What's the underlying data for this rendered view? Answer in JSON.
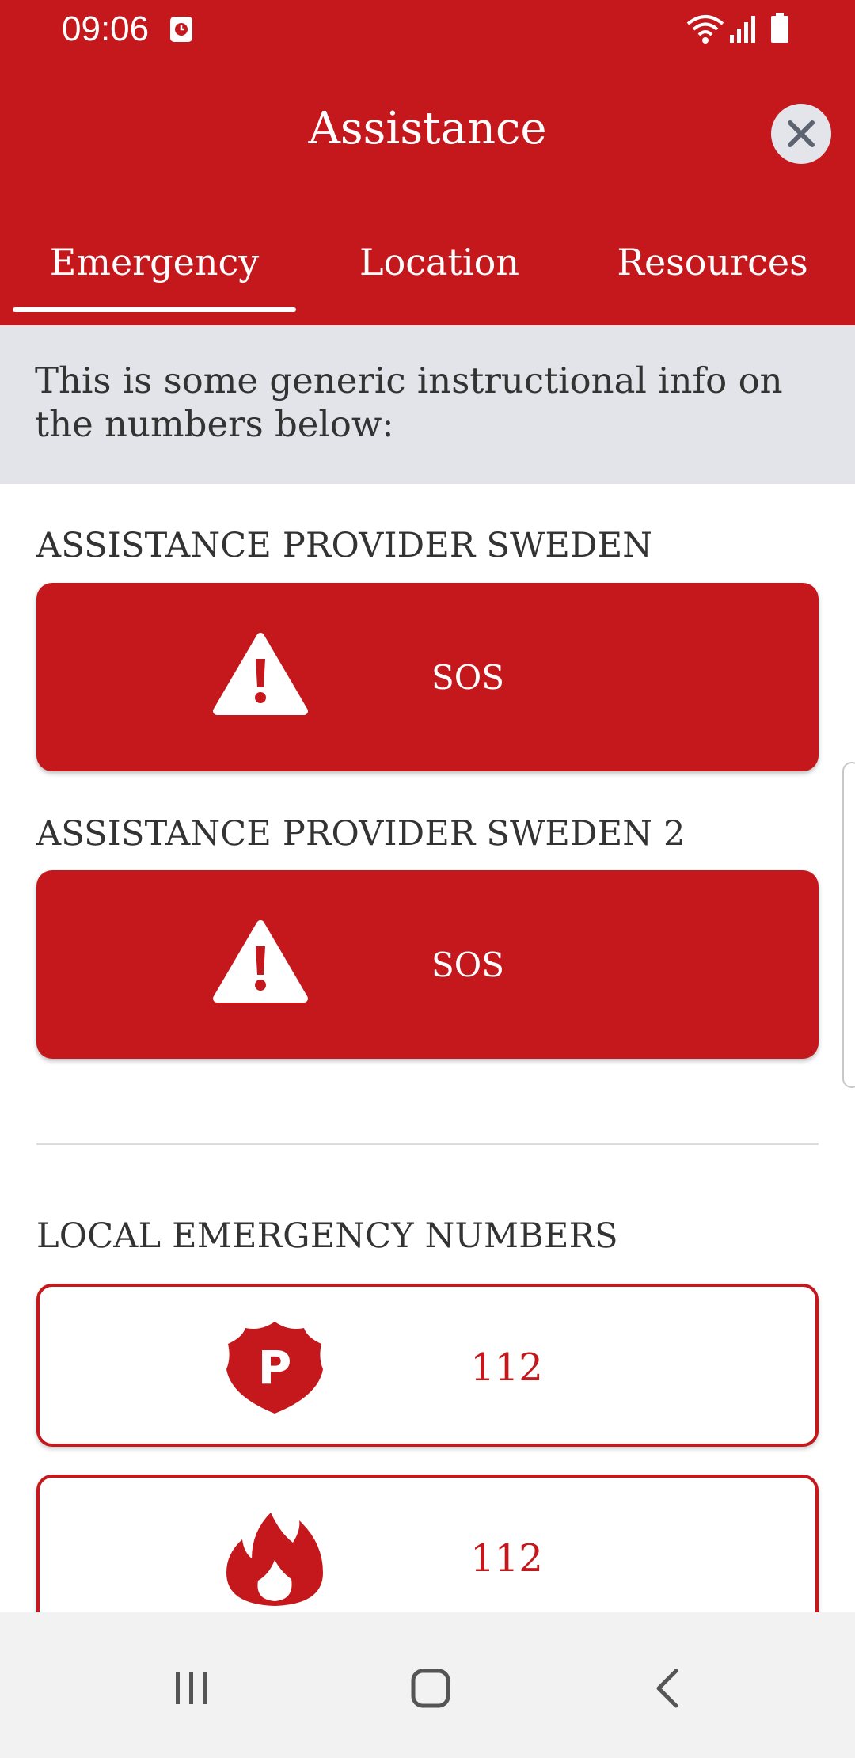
{
  "status_bar": {
    "time": "09:06"
  },
  "header": {
    "title": "Assistance",
    "tabs": [
      {
        "label": "Emergency",
        "active": true
      },
      {
        "label": "Location",
        "active": false
      },
      {
        "label": "Resources",
        "active": false
      }
    ]
  },
  "info": {
    "text": "This is some generic instructional info on the numbers below:"
  },
  "providers": [
    {
      "heading": "ASSISTANCE PROVIDER SWEDEN",
      "button_label": "SOS",
      "icon": "warning-icon"
    },
    {
      "heading": "ASSISTANCE PROVIDER SWEDEN  2",
      "button_label": "SOS",
      "icon": "warning-icon"
    }
  ],
  "local": {
    "heading": "LOCAL EMERGENCY NUMBERS",
    "items": [
      {
        "number": "112",
        "icon": "police-shield-icon"
      },
      {
        "number": "112",
        "icon": "fire-icon"
      }
    ]
  },
  "colors": {
    "brand": "#c5181d",
    "banner": "#e3e4e9",
    "nav_bar": "#f2f2f2"
  }
}
